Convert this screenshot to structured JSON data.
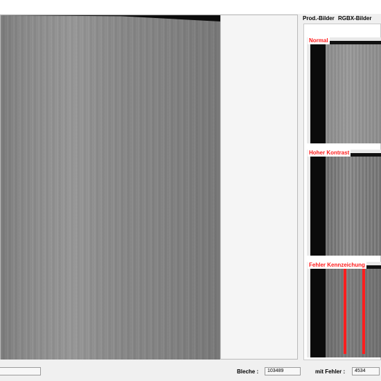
{
  "tabs": [
    {
      "label": "Prod.-Bilder"
    },
    {
      "label": "RGBX-Bilder"
    }
  ],
  "thumbnails": [
    {
      "label": "Normal"
    },
    {
      "label": "Hoher Kontrast"
    },
    {
      "label": "Fehler Kennzeichung"
    }
  ],
  "status": {
    "bleche_label": "Bleche :",
    "bleche_value": "103489",
    "mit_fehler_label": "mit Fehler :",
    "mit_fehler_value": "4534",
    "left_field_value": ""
  },
  "colors": {
    "label_red": "#ff1a1a",
    "defect_red": "#ff1e1e"
  }
}
